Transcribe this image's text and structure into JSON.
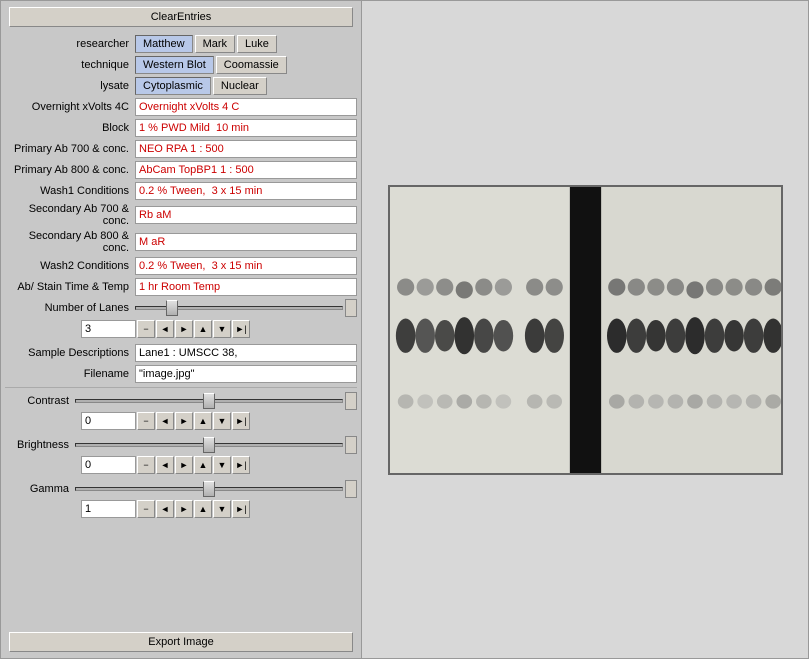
{
  "buttons": {
    "clear_entries": "ClearEntries",
    "export_image": "Export Image"
  },
  "form": {
    "researcher_label": "researcher",
    "technique_label": "technique",
    "lysate_label": "lysate",
    "overnight_label": "Overnight xVolts 4C",
    "block_label": "Block",
    "primary700_label": "Primary Ab 700 & conc.",
    "primary800_label": "Primary Ab 800 & conc.",
    "wash1_label": "Wash1 Conditions",
    "secondary700_label": "Secondary Ab 700 & conc.",
    "secondary800_label": "Secondary Ab 800 & conc.",
    "wash2_label": "Wash2 Conditions",
    "abstain_label": "Ab/ Stain  Time & Temp",
    "numlanes_label": "Number of Lanes",
    "sample_desc_label": "Sample Descriptions",
    "filename_label": "Filename",
    "contrast_label": "Contrast",
    "brightness_label": "Brightness",
    "gamma_label": "Gamma"
  },
  "researchers": [
    {
      "name": "Matthew",
      "active": true
    },
    {
      "name": "Mark",
      "active": false
    },
    {
      "name": "Luke",
      "active": false
    }
  ],
  "techniques": [
    {
      "name": "Western Blot",
      "active": true
    },
    {
      "name": "Coomassie",
      "active": false
    }
  ],
  "lysates": [
    {
      "name": "Cytoplasmic",
      "active": true
    },
    {
      "name": "Nuclear",
      "active": false
    }
  ],
  "fields": {
    "overnight": "Overnight xVolts 4 C",
    "block": "1 % PWD Mild  10 min",
    "primary700": "NEO RPA 1 : 500",
    "primary800": "AbCam TopBP1 1 : 500",
    "wash1": "0.2 % Tween,  3 x 15 min",
    "secondary700": "Rb aM",
    "secondary800": "M aR",
    "wash2": "0.2 % Tween,  3 x 15 min",
    "abstain": "1 hr Room Temp",
    "num_lanes": "3",
    "sample_desc": "Lane1 : UMSCC 38,",
    "filename": "\"image.jpg\""
  },
  "controls": {
    "minus_label": "−",
    "left_label": "◄",
    "right_label": "►",
    "plus_label": "+",
    "up_label": "▲",
    "down_label": "▼",
    "end_label": "►|"
  },
  "sliders": {
    "contrast_value": "0",
    "brightness_value": "0",
    "gamma_value": "1"
  }
}
